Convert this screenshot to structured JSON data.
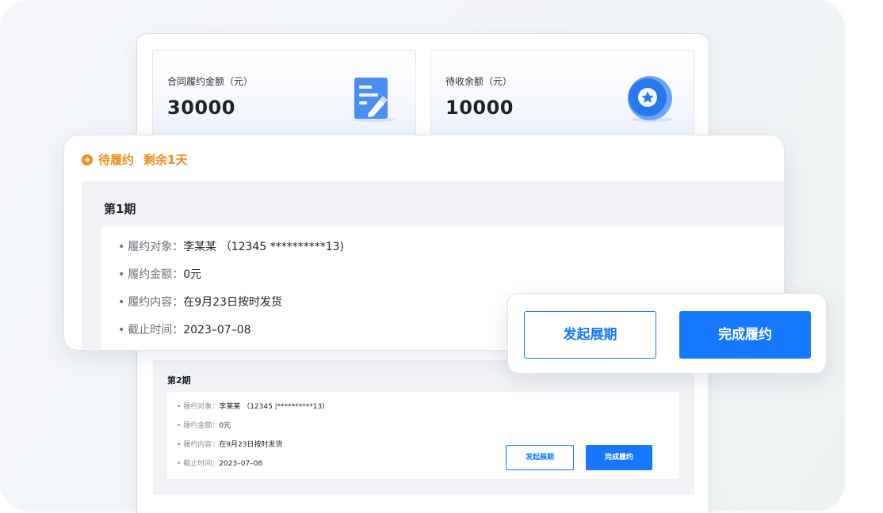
{
  "stats": [
    {
      "label": "合同履约金额（元）",
      "value": "30000",
      "icon": "document-edit-icon"
    },
    {
      "label": "待收余额（元）",
      "value": "10000",
      "icon": "star-coin-icon"
    }
  ],
  "status": {
    "label": "待履约",
    "remain": "剩余1天",
    "icon": "arrow-right-circle-icon",
    "color": "#f08c1c"
  },
  "periods": [
    {
      "title": "第1期",
      "items": [
        {
          "key": "履约对象：",
          "value": "李某某 （12345 **********13)"
        },
        {
          "key": "履约金额：",
          "value": "0元"
        },
        {
          "key": "履约内容：",
          "value": "在9月23日按时发货"
        },
        {
          "key": "截止时间：",
          "value": "2023–07–08"
        }
      ]
    },
    {
      "title": "第2期",
      "items": [
        {
          "key": "履约对象：",
          "value": "李某某 （12345 |**********13)"
        },
        {
          "key": "履约金额：",
          "value": "0元"
        },
        {
          "key": "履约内容：",
          "value": "在9月23日按时发货"
        },
        {
          "key": "截止时间：",
          "value": "2023–07–08"
        }
      ]
    }
  ],
  "actions": {
    "extend": "发起展期",
    "complete": "完成履约"
  },
  "colors": {
    "primary": "#1677ff",
    "warning": "#f08c1c"
  }
}
